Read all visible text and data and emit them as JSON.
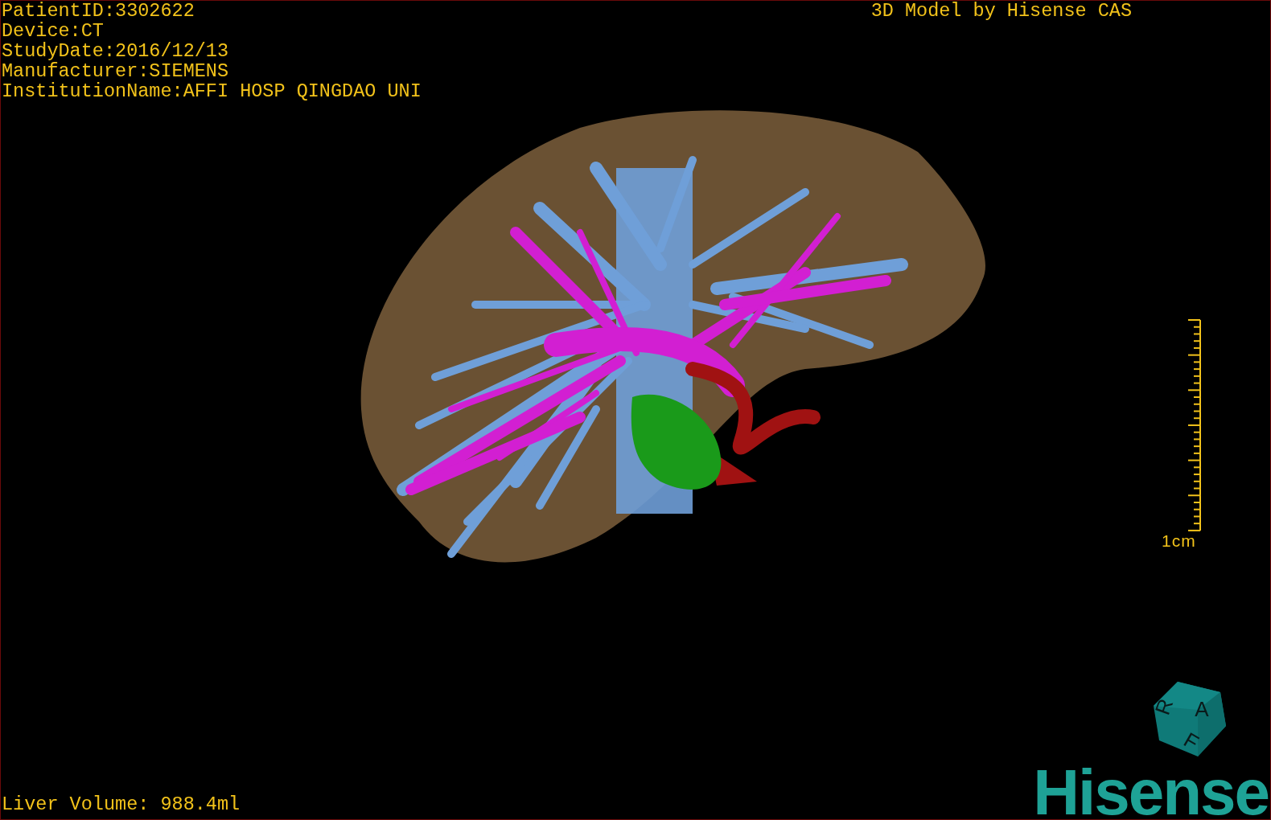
{
  "info_lines": [
    "PatientID:3302622",
    "Device:CT",
    "StudyDate:2016/12/13",
    "Manufacturer:SIEMENS",
    "InstitutionName:AFFI HOSP QINGDAO UNI"
  ],
  "title": "3D Model by Hisense CAS",
  "scale_bar": {
    "label": "1cm"
  },
  "orientation_cube": {
    "faces": [
      {
        "kind": "front",
        "letter": "A"
      },
      {
        "kind": "side",
        "letter": "R"
      },
      {
        "kind": "bottom",
        "letter": "F"
      }
    ]
  },
  "volume": "Liver Volume: 988.4ml",
  "logo": {
    "text": "Hisense"
  }
}
